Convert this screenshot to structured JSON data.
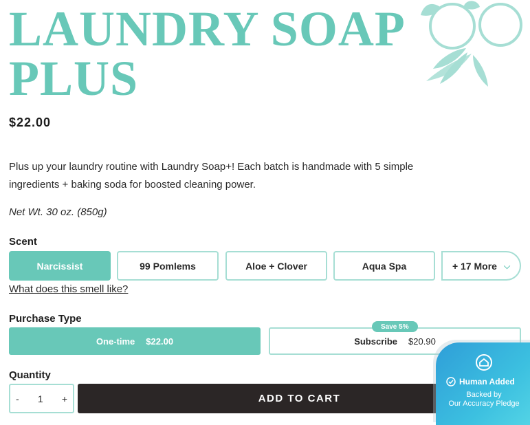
{
  "product": {
    "title_line1": "LAUNDRY SOAP",
    "title_line2": "PLUS",
    "price": "$22.00",
    "description": "Plus up your laundry routine with Laundry Soap+! Each batch is handmade with 5 simple ingredients + baking soda for boosted cleaning power.",
    "net_weight": "Net Wt. 30 oz. (850g)"
  },
  "scent": {
    "label": "Scent",
    "options": [
      "Narcissist",
      "99 Pomlems",
      "Aloe + Clover",
      "Aqua Spa"
    ],
    "selected": "Narcissist",
    "more_label": "+ 17 More",
    "smell_link": "What does this smell like?"
  },
  "purchase": {
    "label": "Purchase Type",
    "one_time_label": "One-time",
    "one_time_price": "$22.00",
    "subscribe_label": "Subscribe",
    "subscribe_price": "$20.90",
    "save_badge": "Save 5%"
  },
  "quantity": {
    "label": "Quantity",
    "minus": "-",
    "value": "1",
    "plus": "+"
  },
  "cart": {
    "label": "ADD TO CART"
  },
  "trust_badge": {
    "line1": "Human Added",
    "line2": "Backed by",
    "line3": "Our Accuracy Pledge"
  },
  "colors": {
    "accent": "#68c8b8",
    "accent_light": "#a6ded4",
    "cart_bg": "#2b2626"
  }
}
